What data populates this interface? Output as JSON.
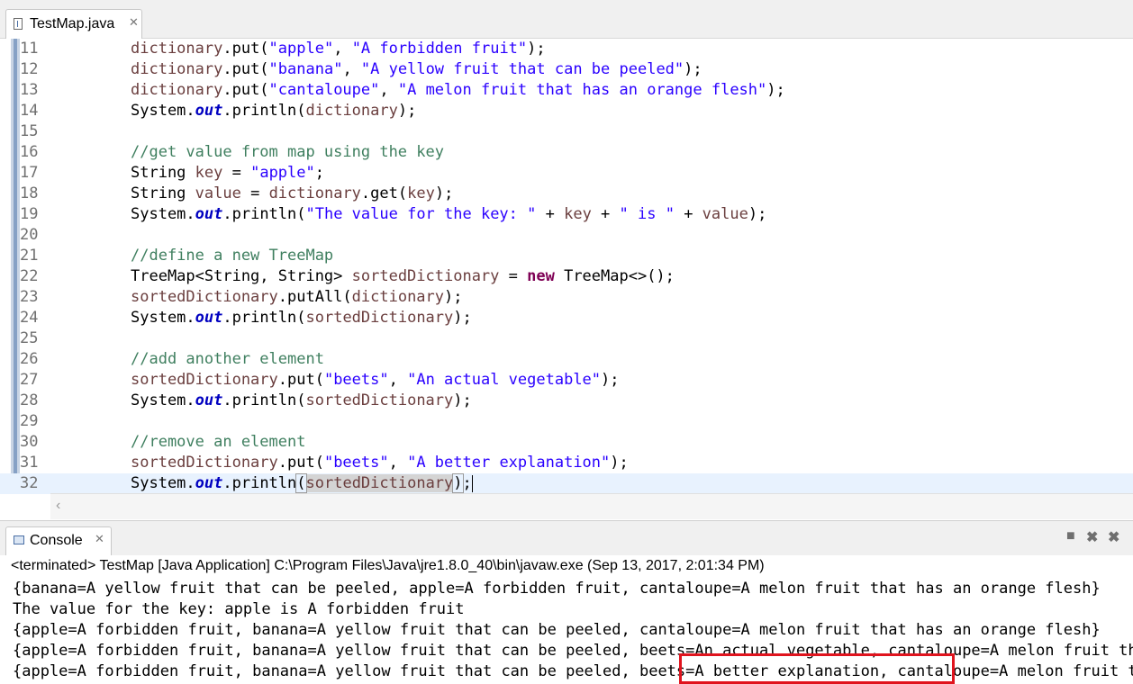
{
  "editor": {
    "tab_label": "TestMap.java",
    "tab_close": "✕",
    "line_numbers": [
      "11",
      "12",
      "13",
      "14",
      "15",
      "16",
      "17",
      "18",
      "19",
      "20",
      "21",
      "22",
      "23",
      "24",
      "25",
      "26",
      "27",
      "28",
      "29",
      "30",
      "31",
      "32"
    ]
  },
  "code": {
    "l11": [
      "dictionary",
      ".put(",
      "\"apple\"",
      ", ",
      "\"A forbidden fruit\"",
      ");"
    ],
    "l12": [
      "dictionary",
      ".put(",
      "\"banana\"",
      ", ",
      "\"A yellow fruit that can be peeled\"",
      ");"
    ],
    "l13": [
      "dictionary",
      ".put(",
      "\"cantaloupe\"",
      ", ",
      "\"A melon fruit that has an orange flesh\"",
      ");"
    ],
    "l14": [
      "System.",
      "out",
      ".println(",
      "dictionary",
      ");"
    ],
    "l16": "//get value from map using the key",
    "l17": [
      "String ",
      "key",
      " = ",
      "\"apple\"",
      ";"
    ],
    "l18": [
      "String ",
      "value",
      " = ",
      "dictionary",
      ".get(",
      "key",
      ");"
    ],
    "l19": [
      "System.",
      "out",
      ".println(",
      "\"The value for the key: \"",
      " + ",
      "key",
      " + ",
      "\" is \"",
      " + ",
      "value",
      ");"
    ],
    "l21": "//define a new TreeMap",
    "l22": [
      "TreeMap<String, String> ",
      "sortedDictionary",
      " = ",
      "new",
      " TreeMap<>();"
    ],
    "l23": [
      "sortedDictionary",
      ".putAll(",
      "dictionary",
      ");"
    ],
    "l24": [
      "System.",
      "out",
      ".println(",
      "sortedDictionary",
      ");"
    ],
    "l26": "//add another element",
    "l27": [
      "sortedDictionary",
      ".put(",
      "\"beets\"",
      ", ",
      "\"An actual vegetable\"",
      ");"
    ],
    "l28": [
      "System.",
      "out",
      ".println(",
      "sortedDictionary",
      ");"
    ],
    "l30": "//remove an element",
    "l31": [
      "sortedDictionary",
      ".put(",
      "\"beets\"",
      ", ",
      "\"A better explanation\"",
      ");"
    ],
    "l32": [
      "System.",
      "out",
      ".println",
      "(",
      "sortedDictionary",
      ")",
      ";"
    ]
  },
  "console": {
    "tab_label": "Console",
    "tab_close": "✕",
    "terminated": "<terminated> TestMap [Java Application] C:\\Program Files\\Java\\jre1.8.0_40\\bin\\javaw.exe (Sep 13, 2017, 2:01:34 PM)",
    "output": [
      "{banana=A yellow fruit that can be peeled, apple=A forbidden fruit, cantaloupe=A melon fruit that has an orange flesh}",
      "The value for the key: apple is A forbidden fruit",
      "{apple=A forbidden fruit, banana=A yellow fruit that can be peeled, cantaloupe=A melon fruit that has an orange flesh}",
      "{apple=A forbidden fruit, banana=A yellow fruit that can be peeled, beets=An actual vegetable, cantaloupe=A melon fruit that has an orange flesh}",
      "{apple=A forbidden fruit, banana=A yellow fruit that can be peeled, beets=A better explanation, cantaloupe=A melon fruit that has an orange flesh}"
    ],
    "icons": [
      "stop-icon",
      "remove-launch-icon",
      "remove-all-terminated-icon"
    ]
  },
  "colors": {
    "keyword": "#7f0055",
    "string": "#2a00ff",
    "comment": "#3f7f5f",
    "field": "#0000c0",
    "variable": "#6a3e3e",
    "highlight_box": "#e0141e"
  }
}
